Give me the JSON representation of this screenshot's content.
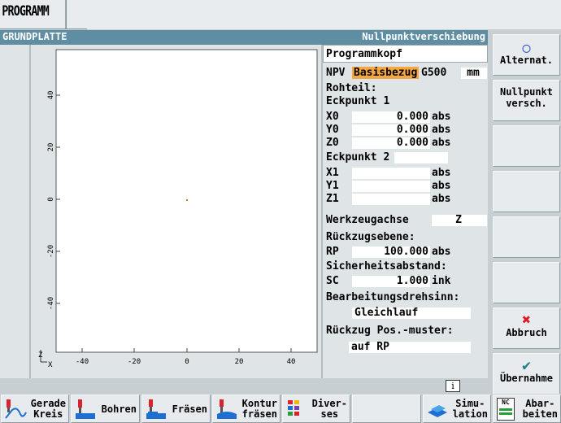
{
  "app": {
    "title": "PROGRAMM"
  },
  "header": {
    "left": "GRUNDPLATTE",
    "right": "Nullpunktverschiebung"
  },
  "plot": {
    "x_ticks": [
      "-40",
      "-20",
      "0",
      "20",
      "40"
    ],
    "y_ticks": [
      "40",
      "20",
      "0",
      "-20",
      "-40"
    ],
    "axis_z": "Z",
    "axis_x": "X",
    "accent": "#e07a00"
  },
  "form": {
    "section": "Programmkopf",
    "npv_label": "NPV",
    "npv_value": "Basisbezug",
    "npv_code": "G500",
    "unit": "mm",
    "rohteil": "Rohteil:",
    "eckpunkt1": "Eckpunkt 1",
    "x0_label": "X0",
    "x0_value": "0.000",
    "x0_unit": "abs",
    "y0_label": "Y0",
    "y0_value": "0.000",
    "y0_unit": "abs",
    "z0_label": "Z0",
    "z0_value": "0.000",
    "z0_unit": "abs",
    "eckpunkt2": "Eckpunkt 2",
    "x1_label": "X1",
    "x1_value": "",
    "x1_unit": "abs",
    "y1_label": "Y1",
    "y1_value": "",
    "y1_unit": "abs",
    "z1_label": "Z1",
    "z1_value": "",
    "z1_unit": "abs",
    "werkzeugachse": "Werkzeugachse",
    "werkzeugachse_value": "Z",
    "rueckzugsebene": "Rückzugsebene:",
    "rp_label": "RP",
    "rp_value": "100.000",
    "rp_unit": "abs",
    "sicherheitsabstand": "Sicherheitsabstand:",
    "sc_label": "SC",
    "sc_value": "1.000",
    "sc_unit": "ink",
    "bearbeitungsdrehsinn": "Bearbeitungsdrehsinn:",
    "drehsinn_value": "Gleichlauf",
    "rueckzug_muster": "Rückzug Pos.-muster:",
    "rueckzug_value": "auf RP"
  },
  "vertical_softkeys": {
    "alternat": "Alternat.",
    "nullpunkt": "Nullpunkt\nversch.",
    "abbruch": "Abbruch",
    "uebernahme": "Übernahme"
  },
  "info_icon": "i",
  "horizontal_softkeys": {
    "gerade_kreis": "Gerade\nKreis",
    "bohren": "Bohren",
    "fraesen": "Fräsen",
    "kontur_fraesen": "Kontur\nfräsen",
    "diverses": "Diver-\nses",
    "simulation": "Simu-\nlation",
    "abarbeiten": "Abar-\nbeiten",
    "nc_label": "NC"
  }
}
